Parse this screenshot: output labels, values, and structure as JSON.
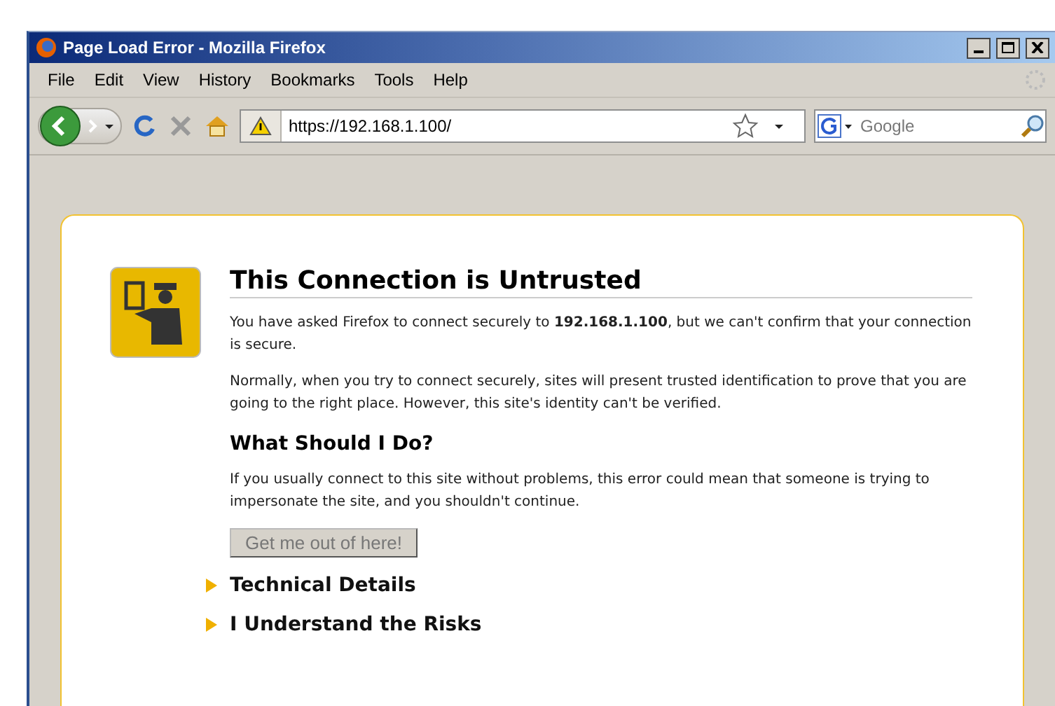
{
  "window": {
    "title": "Page Load Error - Mozilla Firefox"
  },
  "menu": [
    "File",
    "Edit",
    "View",
    "History",
    "Bookmarks",
    "Tools",
    "Help"
  ],
  "address_bar": {
    "value": "https://192.168.1.100/"
  },
  "search": {
    "placeholder": "Google"
  },
  "error_page": {
    "title": "This Connection is Untrusted",
    "paragraphs": [
      "You have asked Firefox to connect securely to **192.168.1.100**, but we can't confirm that your connection is secure.",
      "Normally, when you try to connect securely, sites will present trusted identification to prove that you are going to the right place. However, this site's identity can't be verified."
    ],
    "subheading": "What Should I Do?",
    "advice": "If you usually connect to this site without problems, this error could mean that someone is trying to impersonate the site, and you shouldn't continue.",
    "button": "Get me out of here!",
    "sections": [
      {
        "label": "Technical Details",
        "expanded": false
      },
      {
        "label": "I Understand the Risks",
        "expanded": false
      }
    ]
  }
}
